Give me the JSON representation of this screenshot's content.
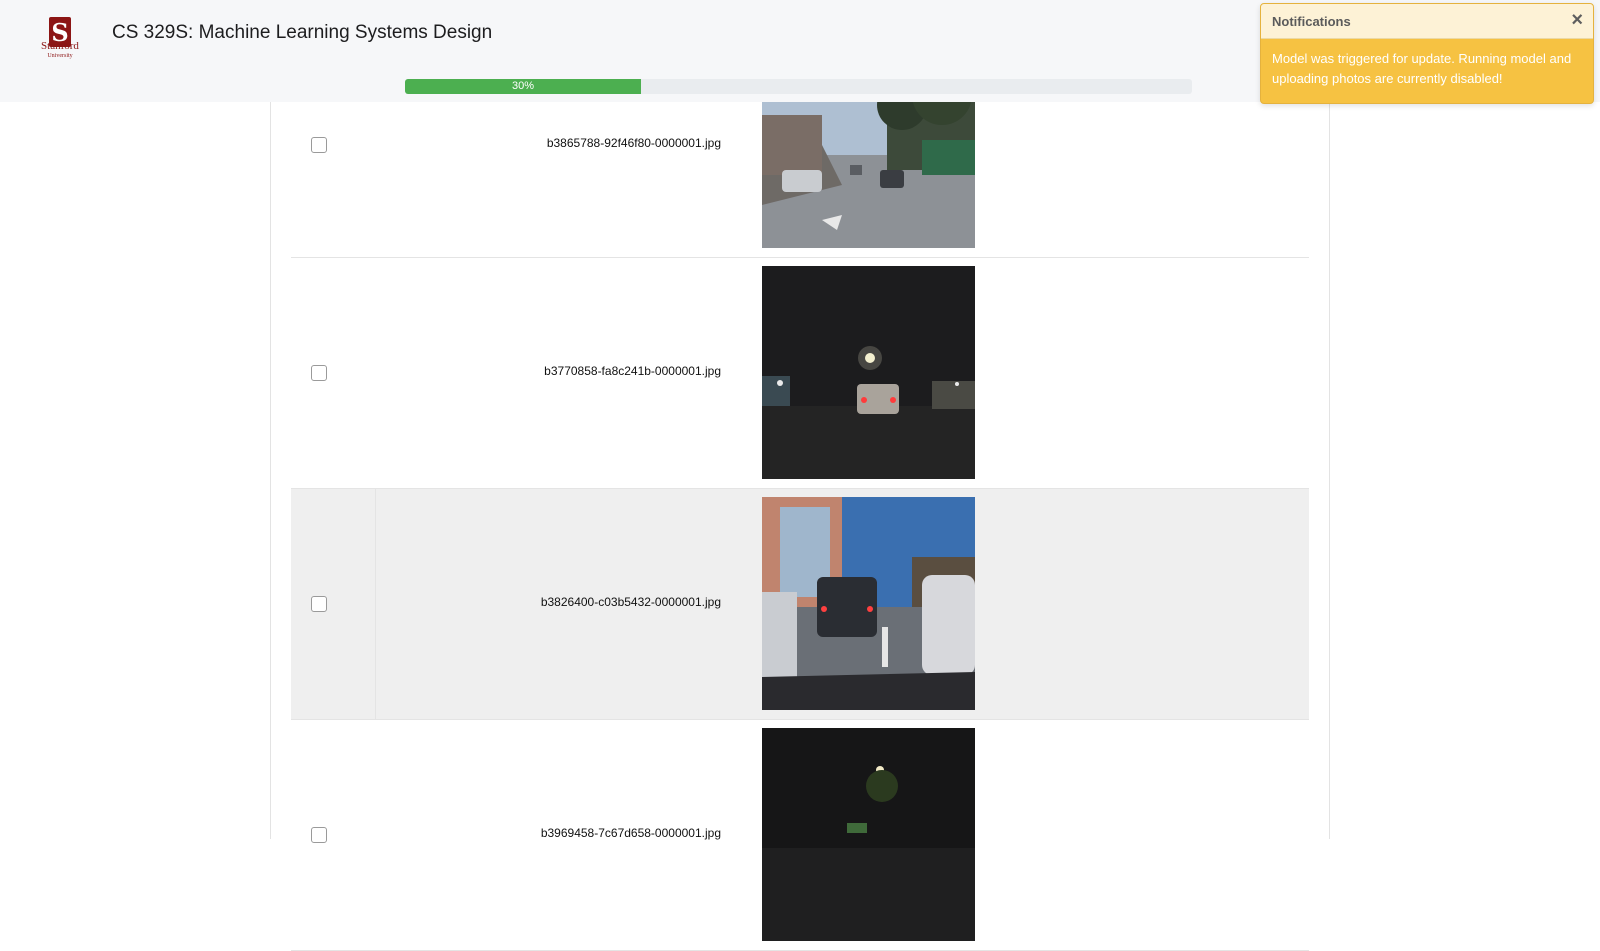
{
  "app": {
    "logo_text": "Stanford",
    "logo_subtext": "University",
    "title": "CS 329S: Machine Learning Systems Design"
  },
  "progress": {
    "value": 0.3,
    "label": "30%"
  },
  "notification": {
    "title": "Notifications",
    "close_icon": "close-icon",
    "message": "Model was triggered for update. Running model and uploading photos are currently disabled!"
  },
  "images": [
    {
      "filename": "b3865788-92f46f80-0000001.jpg",
      "checked": false,
      "scene": "day-street"
    },
    {
      "filename": "b3770858-fa8c241b-0000001.jpg",
      "checked": false,
      "scene": "night-street"
    },
    {
      "filename": "b3826400-c03b5432-0000001.jpg",
      "checked": false,
      "scene": "dusk-traffic",
      "highlighted": true
    },
    {
      "filename": "b3969458-7c67d658-0000001.jpg",
      "checked": false,
      "scene": "night-dark"
    }
  ],
  "colors": {
    "progress": "#4caf50",
    "toast_bg": "#f6c242",
    "brand": "#8c1515"
  }
}
